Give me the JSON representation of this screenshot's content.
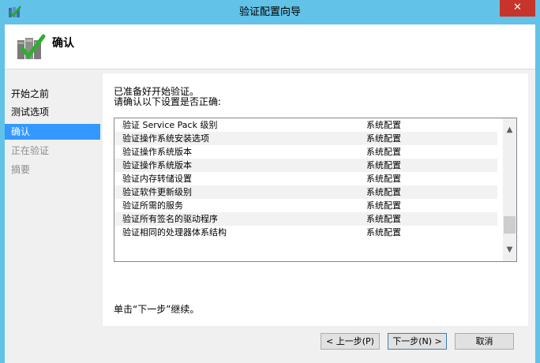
{
  "window": {
    "title": "验证配置向导",
    "close_glyph": "✕"
  },
  "header": {
    "title": "确认"
  },
  "nav": {
    "items": [
      {
        "label": "开始之前",
        "state": "normal"
      },
      {
        "label": "测试选项",
        "state": "normal"
      },
      {
        "label": "确认",
        "state": "selected"
      },
      {
        "label": "正在验证",
        "state": "disabled"
      },
      {
        "label": "摘要",
        "state": "disabled"
      }
    ]
  },
  "main": {
    "intro_line1": "已准备好开始验证。",
    "intro_line2": "请确认以下设置是否正确:",
    "rows": [
      {
        "name": "验证 Service Pack 级别",
        "category": "系统配置"
      },
      {
        "name": "验证操作系统安装选项",
        "category": "系统配置"
      },
      {
        "name": "验证操作系统版本",
        "category": "系统配置"
      },
      {
        "name": "验证操作系统版本",
        "category": "系统配置"
      },
      {
        "name": "验证内存转储设置",
        "category": "系统配置"
      },
      {
        "name": "验证软件更新级别",
        "category": "系统配置"
      },
      {
        "name": "验证所需的服务",
        "category": "系统配置"
      },
      {
        "name": "验证所有签名的驱动程序",
        "category": "系统配置"
      },
      {
        "name": "验证相同的处理器体系结构",
        "category": "系统配置"
      }
    ],
    "hint": "单击“下一步”继续。"
  },
  "footer": {
    "prev_label": "< 上一步(P)",
    "next_label": "下一步(N) >",
    "cancel_label": "取消"
  },
  "colors": {
    "titlebar": "#62c2e8",
    "selection": "#3399ff",
    "close": "#c7342b"
  }
}
